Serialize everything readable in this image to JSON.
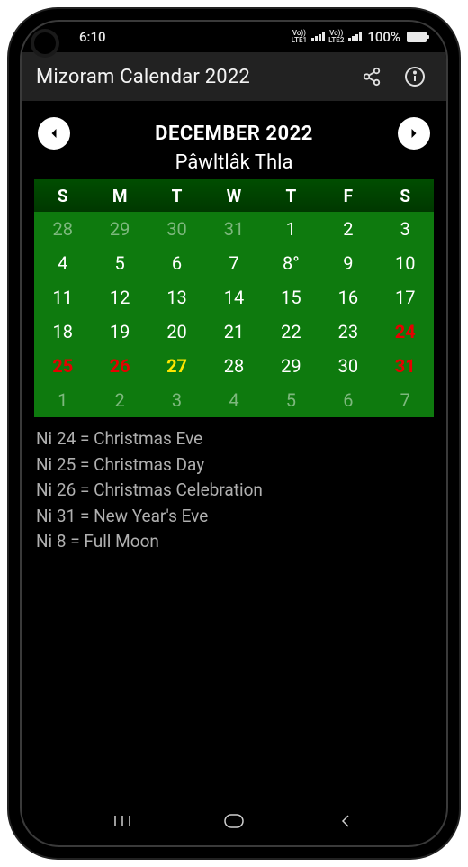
{
  "status": {
    "time": "6:10",
    "net1_top": "Vo))",
    "net1_bot": "LTE1",
    "net2_top": "Vo))",
    "net2_bot": "LTE2",
    "battery": "100%"
  },
  "appbar": {
    "title": "Mizoram Calendar 2022"
  },
  "month": {
    "title": "DECEMBER 2022",
    "subtitle": "Pâwltlâk Thla"
  },
  "weekdays": [
    "S",
    "M",
    "T",
    "W",
    "T",
    "F",
    "S"
  ],
  "grid": [
    [
      {
        "d": "28",
        "faded": true
      },
      {
        "d": "29",
        "faded": true
      },
      {
        "d": "30",
        "faded": true
      },
      {
        "d": "31",
        "faded": true
      },
      {
        "d": "1"
      },
      {
        "d": "2"
      },
      {
        "d": "3"
      }
    ],
    [
      {
        "d": "4"
      },
      {
        "d": "5"
      },
      {
        "d": "6"
      },
      {
        "d": "7"
      },
      {
        "d": "8°"
      },
      {
        "d": "9"
      },
      {
        "d": "10"
      }
    ],
    [
      {
        "d": "11"
      },
      {
        "d": "12"
      },
      {
        "d": "13"
      },
      {
        "d": "14"
      },
      {
        "d": "15"
      },
      {
        "d": "16"
      },
      {
        "d": "17"
      }
    ],
    [
      {
        "d": "18"
      },
      {
        "d": "19"
      },
      {
        "d": "20"
      },
      {
        "d": "21"
      },
      {
        "d": "22"
      },
      {
        "d": "23"
      },
      {
        "d": "24",
        "red": true
      }
    ],
    [
      {
        "d": "25",
        "red": true
      },
      {
        "d": "26",
        "red": true
      },
      {
        "d": "27",
        "today": true
      },
      {
        "d": "28"
      },
      {
        "d": "29"
      },
      {
        "d": "30"
      },
      {
        "d": "31",
        "red": true
      }
    ],
    [
      {
        "d": "1",
        "faded": true
      },
      {
        "d": "2",
        "faded": true
      },
      {
        "d": "3",
        "faded": true
      },
      {
        "d": "4",
        "faded": true
      },
      {
        "d": "5",
        "faded": true
      },
      {
        "d": "6",
        "faded": true
      },
      {
        "d": "7",
        "faded": true
      }
    ]
  ],
  "events": [
    "Ni 24 = Christmas Eve",
    "Ni 25 = Christmas Day",
    "Ni 26 = Christmas Celebration",
    "Ni 31 = New Year's Eve",
    "Ni 8 = Full Moon"
  ]
}
